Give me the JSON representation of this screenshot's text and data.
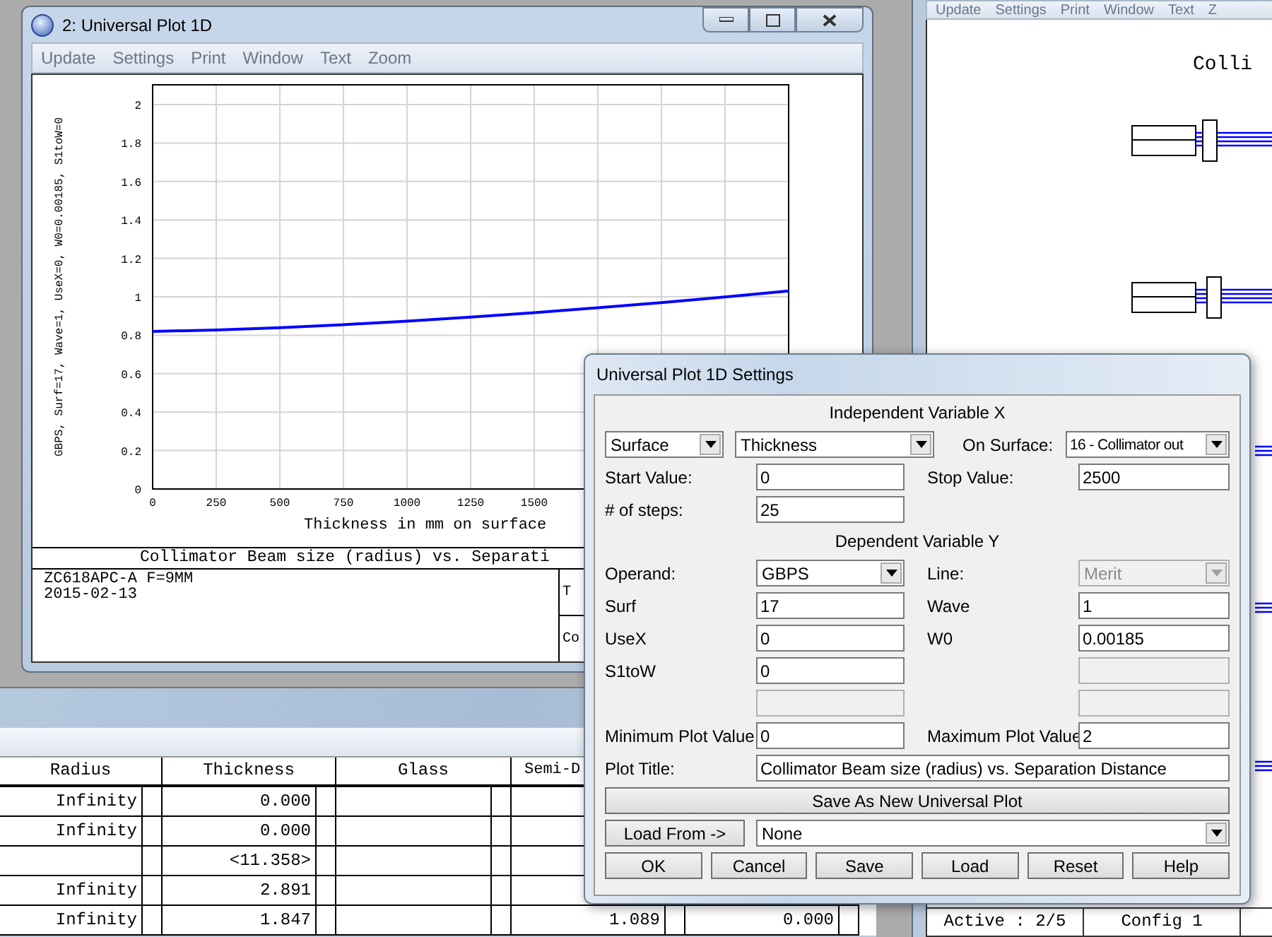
{
  "plot_window": {
    "title": "2: Universal Plot 1D",
    "menu": [
      "Update",
      "Settings",
      "Print",
      "Window",
      "Text",
      "Zoom"
    ],
    "chart_data": {
      "type": "line",
      "ylabel": "GBPS, Surf=17, Wave=1, UseX=0, W0=0.00185, S1toW=0",
      "xlabel": "Thickness in mm on surface",
      "xlim": [
        0,
        2500
      ],
      "ylim": [
        0,
        2
      ],
      "xticks": [
        0,
        250,
        500,
        750,
        1000,
        1250,
        1500
      ],
      "yticks": [
        0,
        0.2,
        0.4,
        0.6,
        0.8,
        1,
        1.2,
        1.4,
        1.6,
        1.8,
        2
      ],
      "x": [
        0,
        250,
        500,
        750,
        1000,
        1250,
        1500,
        1750,
        2000,
        2250,
        2500
      ],
      "grid": true,
      "series": [
        {
          "color": "#0000ff",
          "values": [
            0.82,
            0.827,
            0.839,
            0.855,
            0.873,
            0.894,
            0.918,
            0.943,
            0.97,
            0.999,
            1.03
          ]
        }
      ]
    },
    "plot_title": "Collimator Beam size (radius) vs. Separati",
    "info_lines": [
      "ZC618APC-A F=9MM",
      "2015-02-13"
    ],
    "side_cells": [
      "T",
      "Co"
    ]
  },
  "layout_window": {
    "menu": [
      "Update",
      "Settings",
      "Print",
      "Window",
      "Text",
      "Z"
    ],
    "title": "Colli",
    "status": [
      "Active : 2/5",
      "Config 1"
    ]
  },
  "lens_table": {
    "columns": [
      "Radius",
      "Thickness",
      "Glass",
      "Semi-D"
    ],
    "rows": [
      {
        "radius": "Infinity",
        "thickness": "0.000"
      },
      {
        "radius": "Infinity",
        "thickness": "0.000"
      },
      {
        "thickness": "<11.358>"
      },
      {
        "radius": "Infinity",
        "thickness": "2.891"
      },
      {
        "radius": "Infinity",
        "thickness": "1.847",
        "semi_d": "1.089",
        "column_5": "0.000"
      }
    ]
  },
  "dialog": {
    "title": "Universal Plot 1D Settings",
    "x_heading": "Independent Variable X",
    "x_selectors": [
      "Surface",
      "Thickness"
    ],
    "on_surface_label": "On Surface:",
    "on_surface": "16 - Collimator out",
    "x_fields": [
      {
        "label": "Start Value:",
        "value": "0"
      },
      {
        "label": "Stop Value:",
        "value": "2500"
      },
      {
        "label": "# of steps:",
        "value": "25"
      }
    ],
    "y_heading": "Dependent Variable Y",
    "y_fields": [
      {
        "kind": "dropdown",
        "label": "Operand:",
        "value": "GBPS",
        "disabled": false
      },
      {
        "kind": "dropdown",
        "label": "Line:",
        "value": "Merit",
        "disabled": true
      },
      {
        "kind": "input",
        "label": "Surf",
        "value": "17",
        "disabled": false
      },
      {
        "kind": "input",
        "label": "Wave",
        "value": "1",
        "disabled": false
      },
      {
        "kind": "input",
        "label": "UseX",
        "value": "0",
        "disabled": false
      },
      {
        "kind": "input",
        "label": "W0",
        "value": "0.00185",
        "disabled": false
      },
      {
        "kind": "input",
        "label": "S1toW",
        "value": "0",
        "disabled": false
      },
      {
        "kind": "input",
        "disabled": true
      },
      {
        "kind": "input",
        "disabled": true
      },
      {
        "kind": "input",
        "disabled": true
      },
      {
        "kind": "input",
        "label": "Minimum Plot Value",
        "value": "0",
        "disabled": false
      },
      {
        "kind": "input",
        "label": "Maximum Plot Value",
        "value": "2",
        "disabled": false
      }
    ],
    "plot_title": {
      "label": "Plot Title:",
      "value": "Collimator Beam size (radius) vs. Separation Distance"
    },
    "save_new_button": "Save As New Universal Plot",
    "load_from_button": "Load From ->",
    "load_from_value": "None",
    "buttons": [
      "OK",
      "Cancel",
      "Save",
      "Load",
      "Reset",
      "Help"
    ]
  }
}
